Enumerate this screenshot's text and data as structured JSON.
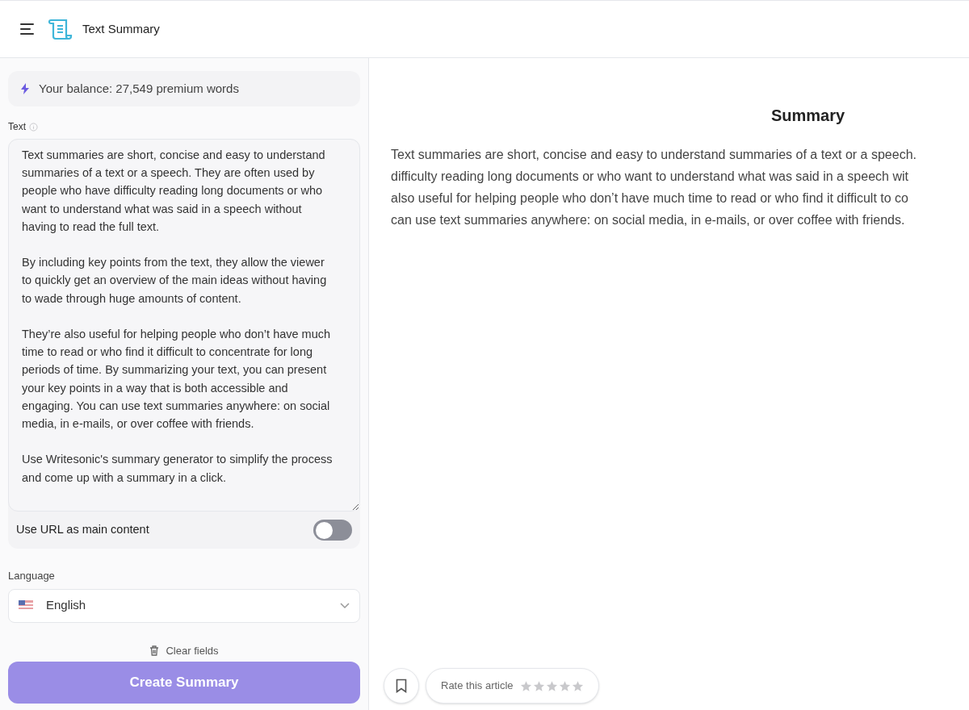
{
  "header": {
    "title": "Text Summary"
  },
  "balance": {
    "text": "Your balance: 27,549 premium words"
  },
  "text_field": {
    "label": "Text",
    "paragraphs": [
      "Text summaries are short, concise and easy to understand summaries of a text or a speech. They are often used by people who have difficulty reading long documents or who want to understand what was said in a speech without having to read the full text.",
      "By including key points from the text, they allow the viewer to quickly get an overview of the main ideas without having to wade through huge amounts of content.",
      "They’re also useful for helping people who don’t have much time to read or who find it difficult to concentrate for long periods of time. By summarizing your text, you can present your key points in a way that is both accessible and engaging. You can use text summaries anywhere: on social media, in e-mails, or over coffee with friends.",
      "Use Writesonic's summary generator to simplify the process and come up with a summary in a click."
    ]
  },
  "url_toggle": {
    "label": "Use URL as main content",
    "on": false
  },
  "language": {
    "label": "Language",
    "value": "English"
  },
  "clear_fields": "Clear fields",
  "create_button": {
    "label": "Create Summary",
    "disabled": true
  },
  "summary": {
    "title": "Summary",
    "lines": [
      "Text summaries are short, concise and easy to understand summaries of a text or a speech.",
      "difficulty reading long documents or who want to understand what was said in a speech wit",
      "also useful for helping people who don’t have much time to read or who find it difficult to co",
      "can use text summaries anywhere: on social media, in e-mails, or over coffee with friends."
    ]
  },
  "rating": {
    "label": "Rate this article",
    "stars": 0
  }
}
